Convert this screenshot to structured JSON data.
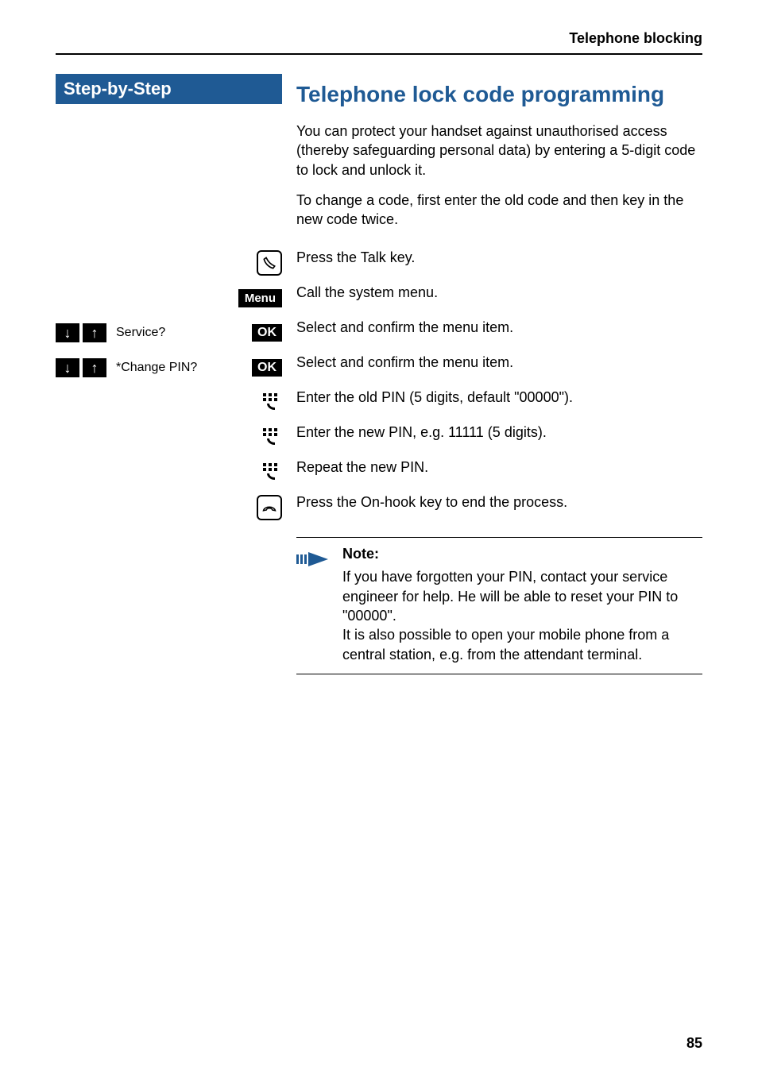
{
  "header": {
    "section_title": "Telephone blocking"
  },
  "sidebar": {
    "heading": "Step-by-Step",
    "rows": [
      {
        "menu_label": "Menu"
      },
      {
        "label": "Service?",
        "ok": "OK"
      },
      {
        "label": "*Change PIN?",
        "ok": "OK"
      }
    ]
  },
  "main": {
    "title": "Telephone lock code programming",
    "intro_1": "You can protect your handset against unauthorised access (thereby safeguarding personal data) by entering a 5-digit code to lock and unlock it.",
    "intro_2": "To change a code, first enter the old code and then key in the new code twice.",
    "steps": [
      "Press the Talk key.",
      "Call the system menu.",
      "Select and confirm the menu item.",
      "Select and confirm the menu item.",
      "Enter the old PIN (5 digits, default \"00000\").",
      "Enter the new PIN, e.g. 11111 (5 digits).",
      "Repeat the new PIN.",
      "Press the On-hook key to end the process."
    ],
    "note_title": "Note:",
    "note_text": "If you have forgotten your PIN, contact your service engineer for help. He will be able to reset your PIN to \"00000\".\nIt is also possible to open your mobile phone from a central station, e.g. from the attendant terminal."
  },
  "page_number": "85"
}
